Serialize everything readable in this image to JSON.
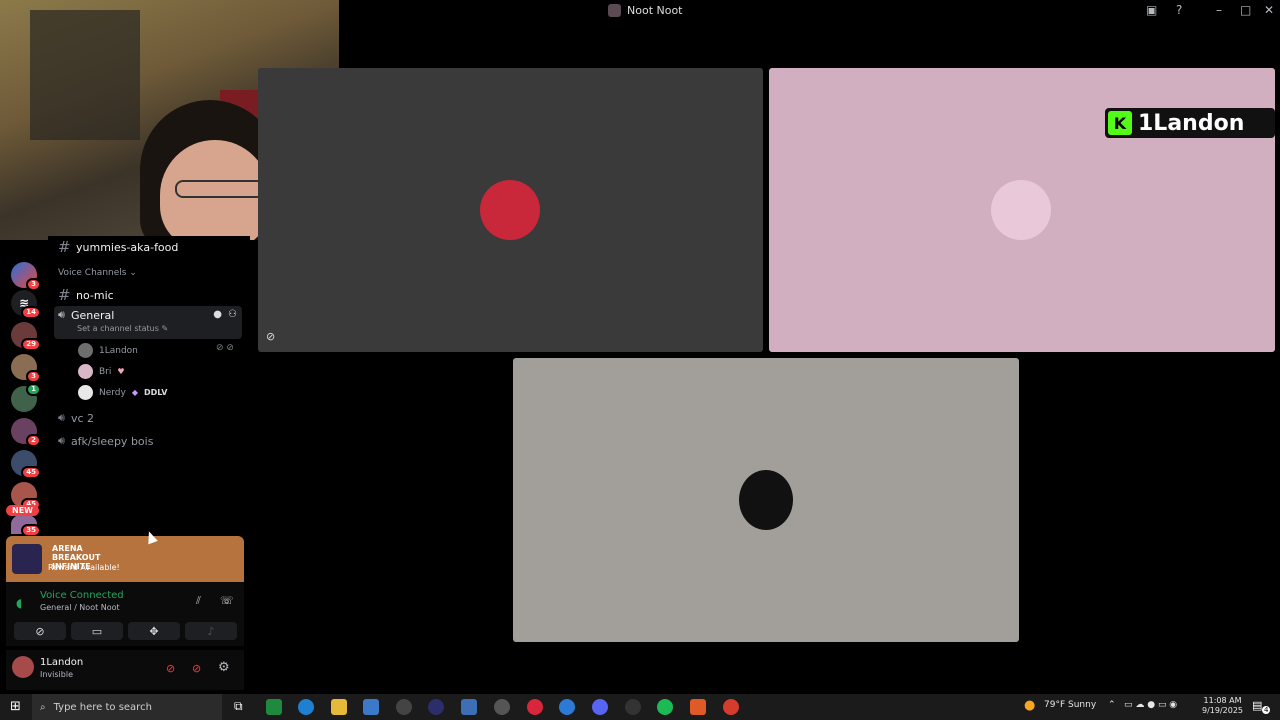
{
  "window": {
    "title": "Noot Noot"
  },
  "webcam": {
    "label": "webcam"
  },
  "channels": {
    "top": "yummies-aka-food",
    "category": "Voice Channels",
    "no_mic": "no-mic",
    "general": "General",
    "general_status": "Set a channel status",
    "members": [
      {
        "name": "1Landon"
      },
      {
        "name": "Bri"
      },
      {
        "name": "Nerdy",
        "tag": "DDLV"
      }
    ],
    "vc2": "vc 2",
    "afk": "afk/sleepy bois"
  },
  "servers": {
    "badges": [
      "3",
      "14",
      "29",
      "3",
      "1",
      "2",
      "45",
      "45",
      "35"
    ],
    "new_label": "NEW"
  },
  "promo": {
    "title": "ARENA BREAKOUT INFINITE",
    "subtitle": "Reward Available!"
  },
  "voice": {
    "status": "Voice Connected",
    "channel": "General / Noot Noot"
  },
  "user": {
    "name": "1Landon",
    "status": "Invisible"
  },
  "tiles": {
    "overlay_name": "1Landon",
    "overlay_prefix": "K"
  },
  "taskbar": {
    "search_placeholder": "Type here to search",
    "weather": "79°F  Sunny",
    "time": "11:08 AM",
    "date": "9/19/2025",
    "notif_count": "4"
  },
  "colors": {
    "accent": "#23a55a",
    "danger": "#f23f43",
    "promo": "#b6733d"
  }
}
